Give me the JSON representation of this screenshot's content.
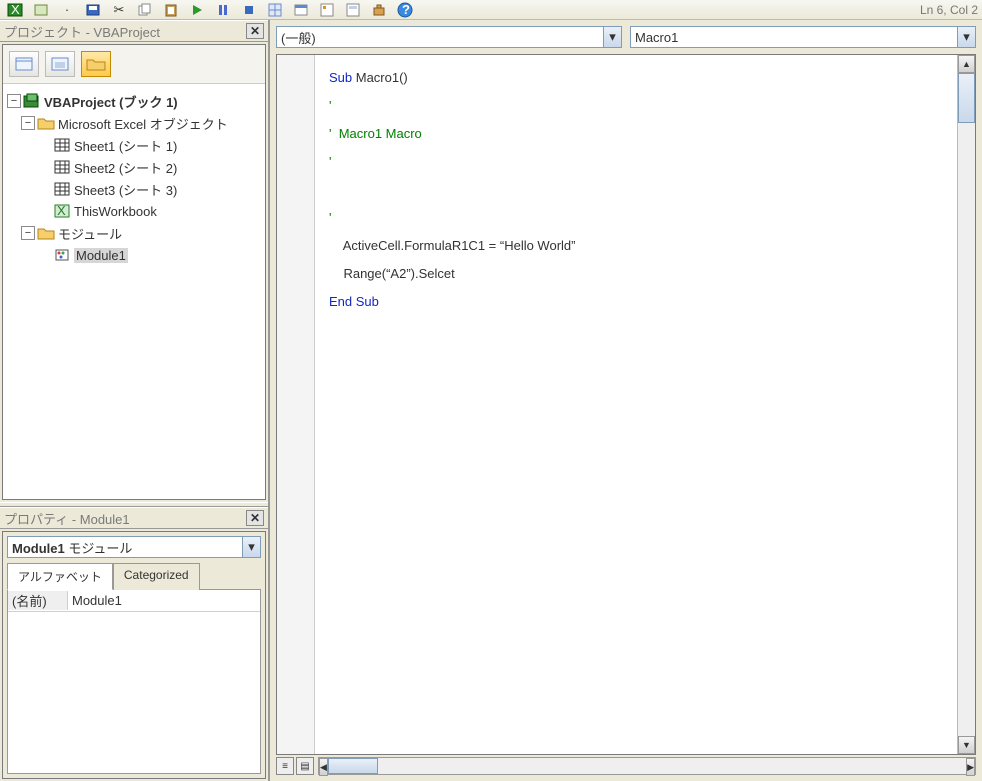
{
  "status": "Ln 6, Col 2",
  "project_panel": {
    "title": "プロジェクト - VBAProject",
    "root": "VBAProject (ブック 1)",
    "folder_objects": "Microsoft Excel オブジェクト",
    "sheet1": "Sheet1 (シート 1)",
    "sheet2": "Sheet2 (シート 2)",
    "sheet3": "Sheet3 (シート 3)",
    "thiswb": "ThisWorkbook",
    "folder_modules": "モジュール",
    "module1": "Module1"
  },
  "properties_panel": {
    "title": "プロパティ - Module1",
    "combo_bold": "Module1",
    "combo_rest": " モジュール",
    "tab_alpha": "アルファベット",
    "tab_cat": "Categorized",
    "row_name": "(名前)",
    "row_val": "Module1"
  },
  "code": {
    "combo_left": "(一般)",
    "combo_right": "Macro1",
    "lines": {
      "l1a": "Sub",
      "l1b": " Macro1()",
      "l2": "'",
      "l3": "'  Macro1 Macro",
      "l4": "'",
      "l5": "",
      "l6": "'",
      "l7": "    ActiveCell.FormulaR1C1 = “Hello World”",
      "l8": "    Range(“A2”).Selcet",
      "l9a": "End Sub"
    }
  }
}
